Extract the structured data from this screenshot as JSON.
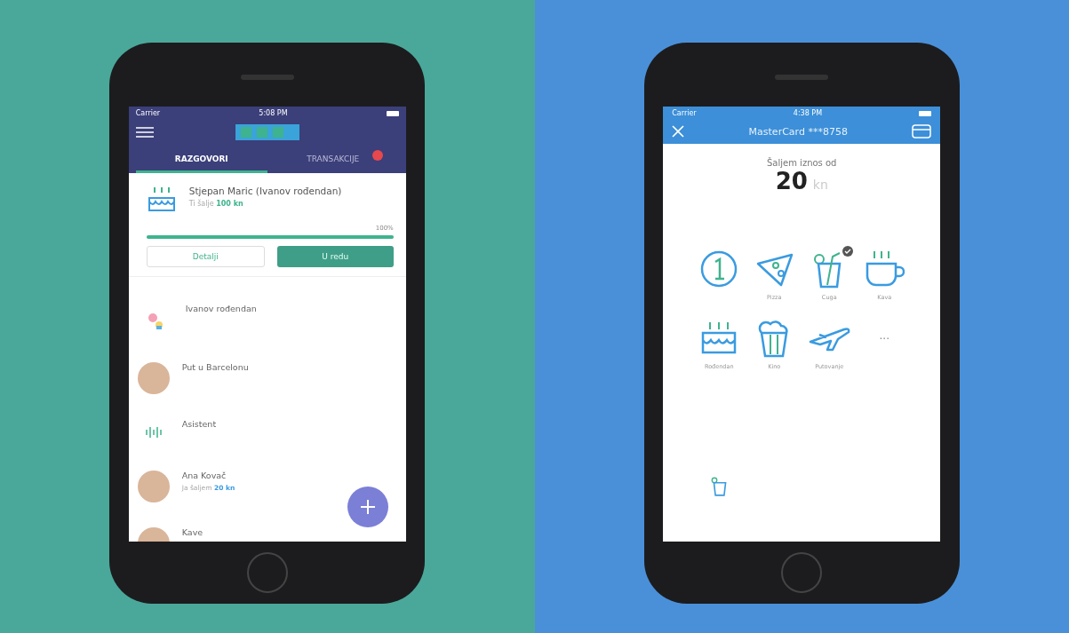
{
  "left_phone": {
    "status_bar": {
      "carrier": "Carrier",
      "time": "5:08 PM"
    },
    "tabs": [
      {
        "label": "RAZGOVORI",
        "selected": true,
        "badge": false
      },
      {
        "label": "TRANSAKCIJE",
        "selected": false,
        "badge": true
      }
    ],
    "request": {
      "title": "Stjepan Maric (Ivanov rođendan)",
      "prefix": "Ti šalje",
      "amount": "100 kn",
      "percent": "100%",
      "level": 1,
      "buttons": [
        {
          "label": "Detalji",
          "kind": "outline"
        },
        {
          "label": "U redu",
          "kind": "filled"
        }
      ]
    },
    "conversations": [
      {
        "name": "Ivanov rođendan",
        "kind": "drawing"
      },
      {
        "name": "Put u Barcelonu",
        "kind": "photo"
      },
      {
        "name": "Asistent",
        "kind": "wave"
      },
      {
        "name": "Ana Kovač",
        "kind": "photo",
        "prefix": "Ja šaljem",
        "amount": "20 kn"
      },
      {
        "name": "Kave",
        "kind": "photo"
      }
    ]
  },
  "right_phone": {
    "status_bar": {
      "carrier": "Carrier",
      "time": "4:38 PM"
    },
    "title": "MasterCard ***8758",
    "amount_label": "Šaljem iznos od",
    "amount": "20",
    "currency": "kn",
    "categories": [
      {
        "kind": "coin",
        "selected": false
      },
      {
        "kind": "pizza",
        "label": "Pizza",
        "selected": false
      },
      {
        "kind": "drink",
        "label": "Cuga",
        "selected": true
      },
      {
        "kind": "coffee",
        "label": "Kava",
        "selected": false
      },
      {
        "kind": "cake",
        "label": "Rođendan",
        "selected": false
      },
      {
        "kind": "popcorn",
        "label": "Kino",
        "selected": false
      },
      {
        "kind": "plane",
        "label": "Putovanje",
        "selected": false
      },
      {
        "kind": "more",
        "label": "...",
        "selected": false
      }
    ]
  }
}
